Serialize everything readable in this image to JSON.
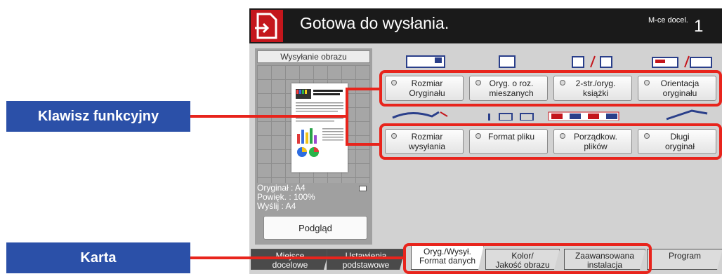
{
  "callouts": {
    "function_key": "Klawisz funkcyjny",
    "tab": "Karta"
  },
  "header": {
    "status": "Gotowa do wysłania.",
    "destination_label": "M-ce docel.",
    "destination_count": "1"
  },
  "left_panel": {
    "title": "Wysyłanie obrazu",
    "original": "Oryginał  :  A4",
    "zoom": "Powięk.  :  100%",
    "send": "Wyślij      :  A4",
    "preview_button": "Podgląd"
  },
  "function_keys_row1": [
    {
      "line1": "Rozmiar",
      "line2": "Oryginału"
    },
    {
      "line1": "Oryg. o roz.",
      "line2": "mieszanych"
    },
    {
      "line1": "2-str./oryg.",
      "line2": "książki"
    },
    {
      "line1": "Orientacja",
      "line2": "oryginału"
    }
  ],
  "function_keys_row2": [
    {
      "line1": "Rozmiar",
      "line2": "wysyłania"
    },
    {
      "line1": "Format pliku",
      "line2": ""
    },
    {
      "line1": "Porządkow.",
      "line2": "plików"
    },
    {
      "line1": "Długi",
      "line2": "oryginał"
    }
  ],
  "tabs": [
    {
      "line1": "Miejsce",
      "line2": "docelowe"
    },
    {
      "line1": "Ustawienia",
      "line2": "podstawowe"
    },
    {
      "line1": "Oryg./Wysył.",
      "line2": "Format danych"
    },
    {
      "line1": "Kolor/",
      "line2": "Jakość obrazu"
    },
    {
      "line1": "Zaawansowana",
      "line2": "instalacja"
    },
    {
      "line1": "Program",
      "line2": ""
    }
  ],
  "colors": {
    "callout_blue": "#2b50a8",
    "highlight_red": "#e8241c",
    "header_black": "#1a1a1a",
    "icon_red": "#c4161c"
  },
  "icons": [
    "send-document-icon",
    "status-dot-icon"
  ]
}
